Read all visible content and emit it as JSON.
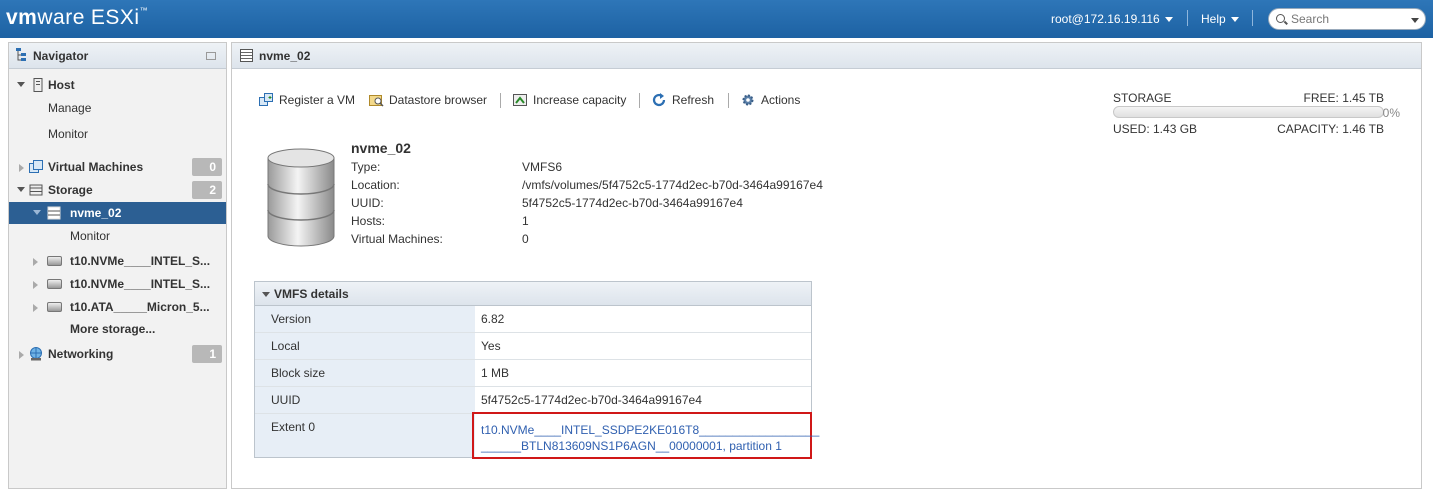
{
  "app": {
    "brand_vm": "vm",
    "brand_ware": "ware",
    "brand_product": "ESXi",
    "brand_tm": "™"
  },
  "topbar": {
    "user": "root@172.16.19.116",
    "help": "Help",
    "search_placeholder": "Search",
    "separator": "|"
  },
  "navigator": {
    "title": "Navigator",
    "items": [
      {
        "label": "Host",
        "level": 0,
        "expanded": true,
        "icon": "host-icon"
      },
      {
        "label": "Manage",
        "level": 1
      },
      {
        "label": "Monitor",
        "level": 1
      },
      {
        "label": "Virtual Machines",
        "level": 0,
        "badge": "0",
        "icon": "vm-icon"
      },
      {
        "label": "Storage",
        "level": 0,
        "badge": "2",
        "expanded": true,
        "icon": "storage-icon"
      },
      {
        "label": "nvme_02",
        "level": 1,
        "selected": true,
        "icon": "datastore-icon"
      },
      {
        "label": "Monitor",
        "level": 2
      },
      {
        "label": "t10.NVMe____INTEL_S...",
        "level": 1,
        "icon": "disk-icon"
      },
      {
        "label": "t10.NVMe____INTEL_S...",
        "level": 1,
        "icon": "disk-icon"
      },
      {
        "label": "t10.ATA_____Micron_5...",
        "level": 1,
        "icon": "disk-icon"
      },
      {
        "label": "More storage...",
        "level": 2
      },
      {
        "label": "Networking",
        "level": 0,
        "badge": "1",
        "icon": "network-icon"
      }
    ]
  },
  "main": {
    "title": "nvme_02",
    "toolbar": [
      {
        "label": "Register a VM",
        "icon": "register-vm-icon"
      },
      {
        "label": "Datastore browser",
        "icon": "datastore-browser-icon"
      },
      {
        "label": "Increase capacity",
        "icon": "increase-capacity-icon"
      },
      {
        "label": "Refresh",
        "icon": "refresh-icon"
      },
      {
        "label": "Actions",
        "icon": "gear-icon"
      }
    ],
    "datastore": {
      "name": "nvme_02",
      "fields": [
        {
          "label": "Type:",
          "value": "VMFS6"
        },
        {
          "label": "Location:",
          "value": "/vmfs/volumes/5f4752c5-1774d2ec-b70d-3464a99167e4"
        },
        {
          "label": "UUID:",
          "value": "5f4752c5-1774d2ec-b70d-3464a99167e4"
        },
        {
          "label": "Hosts:",
          "value": "1"
        },
        {
          "label": "Virtual Machines:",
          "value": "0"
        }
      ]
    },
    "storage": {
      "heading": "STORAGE",
      "free": "FREE: 1.45 TB",
      "percent": "0%",
      "used": "USED: 1.43 GB",
      "capacity": "CAPACITY: 1.46 TB",
      "used_fraction": 0.001
    },
    "vmfs_details": {
      "title": "VMFS details",
      "rows": [
        {
          "label": "Version",
          "value": "6.82"
        },
        {
          "label": "Local",
          "value": "Yes"
        },
        {
          "label": "Block size",
          "value": "1 MB"
        },
        {
          "label": "UUID",
          "value": "5f4752c5-1774d2ec-b70d-3464a99167e4"
        },
        {
          "label": "Extent 0",
          "value_line1": "t10.NVMe____INTEL_SSDPE2KE016T8__________________",
          "value_line2": "______BTLN813609NS1P6AGN__00000001, partition 1"
        }
      ]
    }
  }
}
